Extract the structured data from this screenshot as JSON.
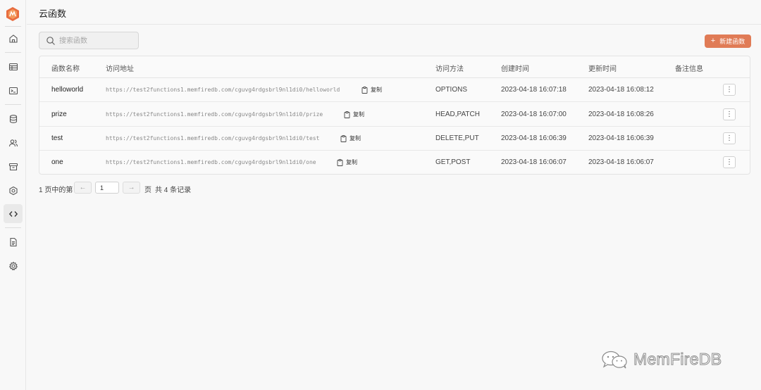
{
  "page": {
    "title": "云函数"
  },
  "search": {
    "placeholder": "搜索函数"
  },
  "toolbar": {
    "new_button_label": "新建函数",
    "new_button_icon": "plus-icon",
    "accent_color": "#e07b56"
  },
  "sidebar": {
    "items": [
      {
        "icon": "home-icon",
        "active": false
      },
      {
        "icon": "table-icon",
        "active": false
      },
      {
        "icon": "terminal-icon",
        "active": false
      },
      {
        "icon": "database-icon",
        "active": false
      },
      {
        "icon": "users-icon",
        "active": false
      },
      {
        "icon": "archive-icon",
        "active": false
      },
      {
        "icon": "hexagon-icon",
        "active": false
      },
      {
        "icon": "code-icon",
        "active": true
      },
      {
        "icon": "document-icon",
        "active": false
      },
      {
        "icon": "gear-icon",
        "active": false
      }
    ]
  },
  "table": {
    "columns": [
      "函数名称",
      "访问地址",
      "访问方法",
      "创建时间",
      "更新时间",
      "备注信息"
    ],
    "copy_label": "复制",
    "rows": [
      {
        "name": "helloworld",
        "url": "https://test2functions1.memfiredb.com/cguvg4rdgsbrl9nl1di0/helloworld",
        "method": "OPTIONS",
        "created": "2023-04-18 16:07:18",
        "updated": "2023-04-18 16:08:12",
        "note": ""
      },
      {
        "name": "prize",
        "url": "https://test2functions1.memfiredb.com/cguvg4rdgsbrl9nl1di0/prize",
        "method": "HEAD,PATCH",
        "created": "2023-04-18 16:07:00",
        "updated": "2023-04-18 16:08:26",
        "note": ""
      },
      {
        "name": "test",
        "url": "https://test2functions1.memfiredb.com/cguvg4rdgsbrl9nl1di0/test",
        "method": "DELETE,PUT",
        "created": "2023-04-18 16:06:39",
        "updated": "2023-04-18 16:06:39",
        "note": ""
      },
      {
        "name": "one",
        "url": "https://test2functions1.memfiredb.com/cguvg4rdgsbrl9nl1di0/one",
        "method": "GET,POST",
        "created": "2023-04-18 16:06:07",
        "updated": "2023-04-18 16:06:07",
        "note": ""
      }
    ]
  },
  "pagination": {
    "prefix": "1 页中的第",
    "current_page": "1",
    "suffix": "页",
    "total": "共 4 条记录"
  },
  "watermark": {
    "text": "MemFireDB"
  }
}
